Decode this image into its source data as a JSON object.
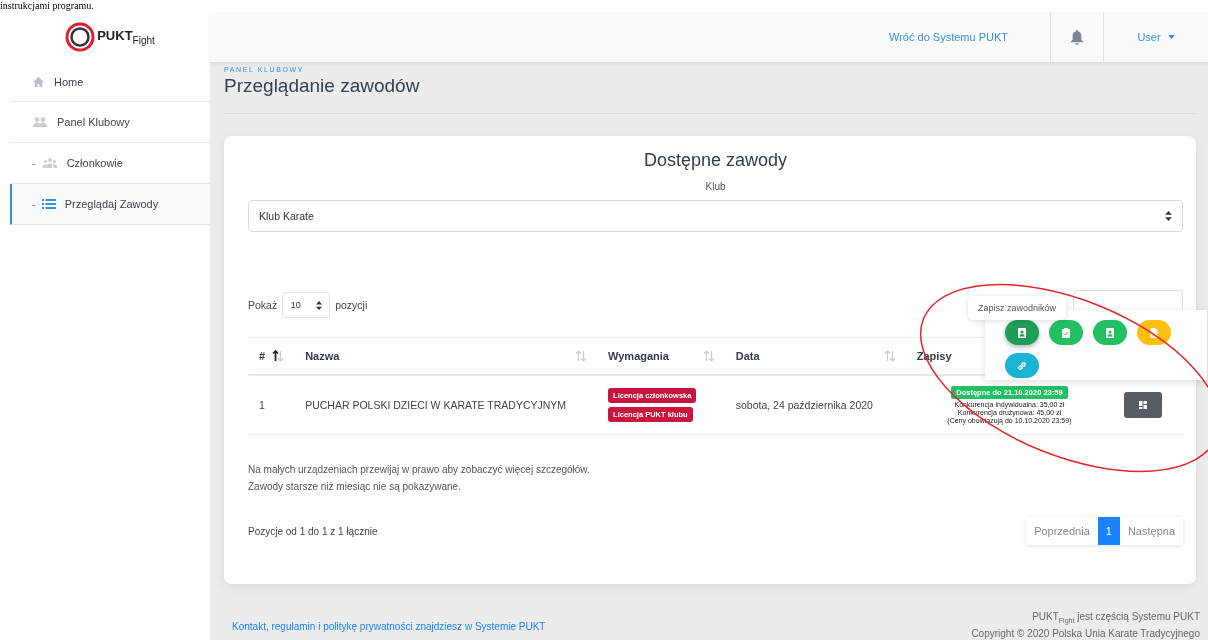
{
  "document_text": "instrukcjami programu.",
  "logo": {
    "text": "PUKT$_{Fight}$"
  },
  "sidebar": {
    "items": [
      {
        "label": "Home",
        "selected": false
      },
      {
        "label": "Panel Klubowy",
        "selected": false,
        "children": [
          {
            "marker": "-",
            "label": "Członkowie",
            "selected": false
          },
          {
            "marker": "-",
            "label": "Przeglądaj Zawody",
            "selected": true
          }
        ]
      }
    ]
  },
  "header": {
    "link": "Wróć do Systemu PUKT",
    "user": "User"
  },
  "page": {
    "breadcrumb": "PANEL KLUBOWY",
    "title": "Przeglądanie zawodów"
  },
  "card": {
    "title": "Dostępne zawody",
    "club_label": "Klub",
    "club_select": {
      "value": "Klub Karate"
    },
    "length": {
      "before": "Pokaż",
      "value": "10",
      "after": "pozycji"
    },
    "table": {
      "columns": [
        {
          "label": "#",
          "sortable": true,
          "sorted_asc": true
        },
        {
          "label": "Nazwa",
          "sortable": true,
          "sorted_asc": false
        },
        {
          "label": "Wymagania",
          "sortable": true,
          "sorted_asc": false
        },
        {
          "label": "Data",
          "sortable": true,
          "sorted_asc": false
        },
        {
          "label": "Zapisy",
          "sortable": false
        }
      ],
      "rows": [
        {
          "cells": [
            "1",
            "PUCHAR POLSKI DZIECI W KARATE TRADYCYJNYM"
          ],
          "requirements": [
            "Licencja członkowska",
            "Licencja PUKT klubu"
          ],
          "date": "sobota, 24 października 2020",
          "availability": "Dostępne do 21.10.2020 23:59",
          "prices": [
            "Konkurencja indywidualna: 35,00 zł",
            "Konkurencja drużynowa: 45,00 zł",
            "(Ceny obowiązują do 10.10.2020 23:59)"
          ]
        }
      ]
    },
    "notes": [
      "Na małych urządzeniach przewijaj w prawo aby zobaczyć więcej szczegółów.",
      "Zawody starsze niż miesiąc nie są pokazywane."
    ],
    "info": "Pozycje od 1 do 1 z 1 łącznie",
    "pagination": [
      {
        "label": "Poprzednia",
        "selected": false
      },
      {
        "label": "1",
        "selected": true
      },
      {
        "label": "Następna",
        "selected": false
      }
    ],
    "popover": {
      "tooltip": "Zapisz zawodników",
      "actions": [
        {
          "color": "#1e9e57",
          "selected": true
        },
        {
          "color": "#22c063",
          "selected": false
        },
        {
          "color": "#22c063",
          "selected": false
        },
        {
          "color": "#fcbf12",
          "selected": false
        },
        {
          "color": "#19b3d6",
          "selected": false
        }
      ]
    }
  },
  "footer": {
    "link": "Kontakt, regulamin i politykę prywatności znajdziesz w Systemie PUKT",
    "lines": [
      "PUKT$_{Fight}$ jest częścią Systemu PUKT",
      "Copyright © 2020 Polska Unia Karate Tradycyjnego"
    ]
  }
}
